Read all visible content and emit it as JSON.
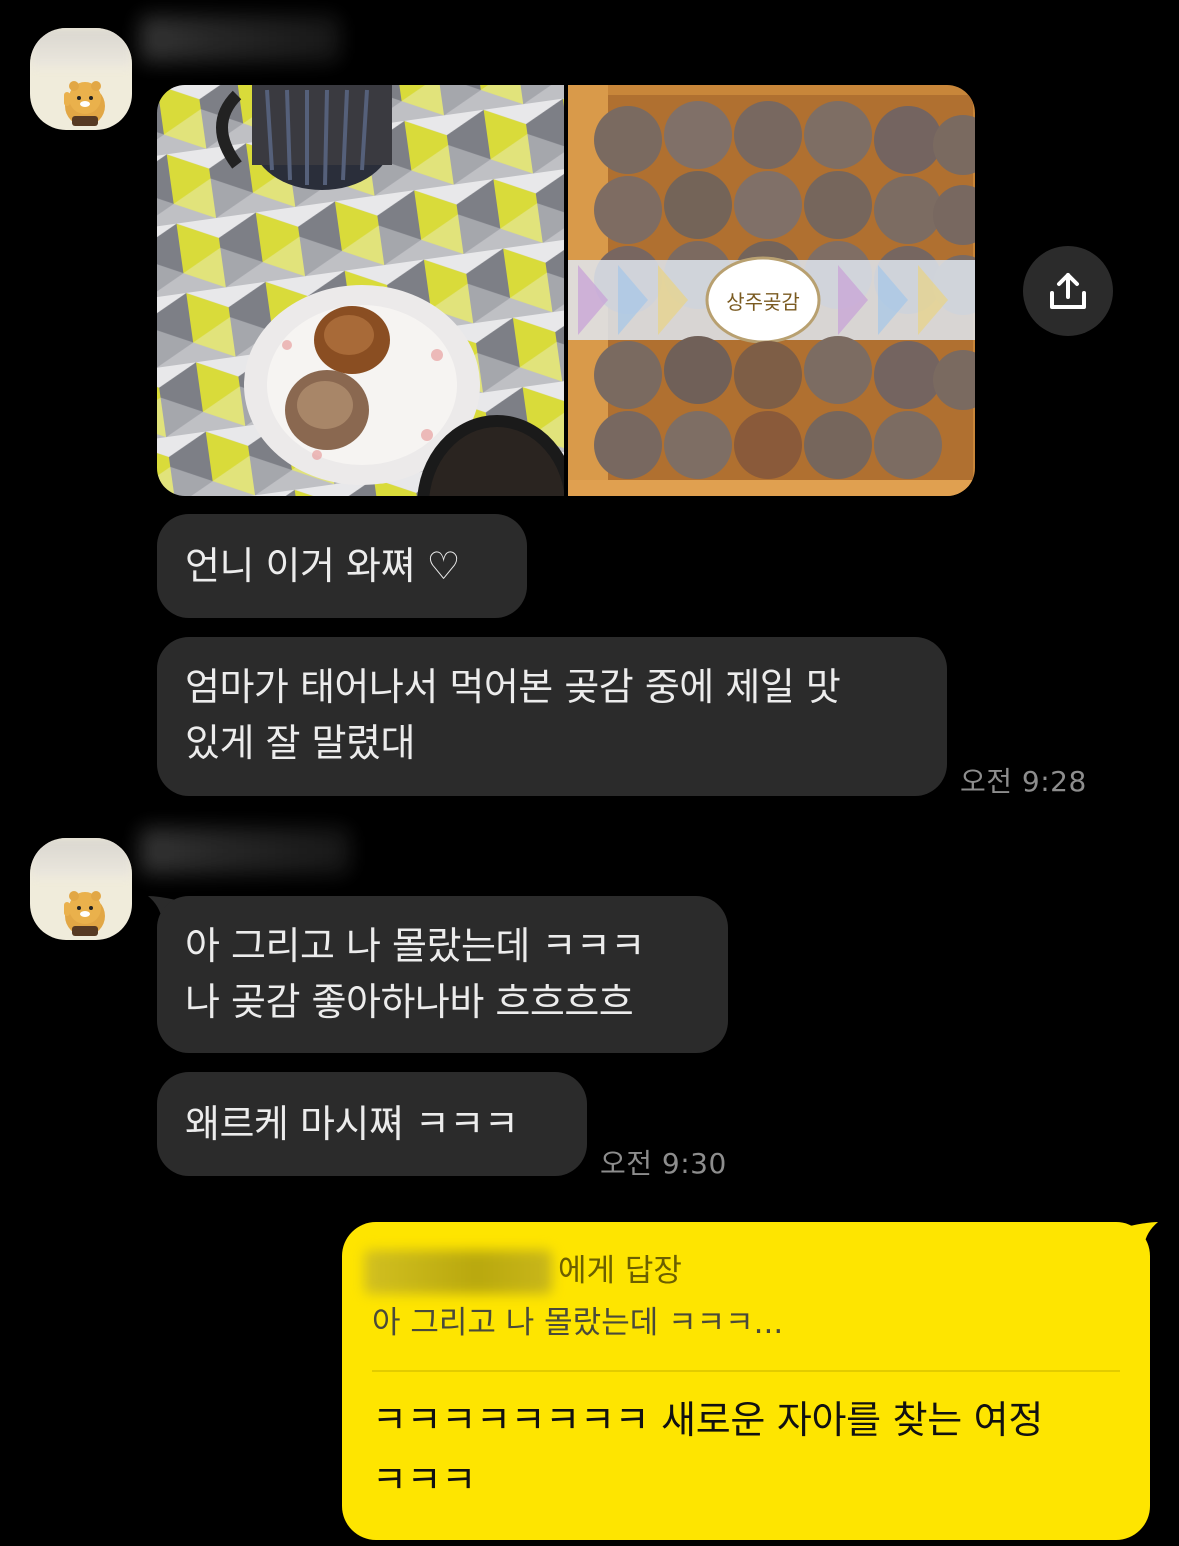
{
  "messages": {
    "group1": {
      "bubble1": "언니 이거 와쪄 ♡",
      "bubble2": "엄마가 태어나서 먹어본 곶감 중에 제일 맛\n있게 잘 말렸대",
      "time": "오전 9:28"
    },
    "group2": {
      "bubble1": "아 그리고 나 몰랐는데 ㅋㅋㅋ\n나 곶감 좋아하나바 흐흐흐흐",
      "bubble2": "왜르케 마시쪄 ㅋㅋㅋ",
      "time": "오전 9:30"
    }
  },
  "reply": {
    "header_suffix": "에게 답장",
    "quoted": "아 그리고 나 몰랐는데 ㅋㅋㅋ...",
    "text": "ㅋㅋㅋㅋㅋㅋㅋㅋ 새로운 자아를 찾는 여정\nㅋㅋㅋ"
  },
  "photo": {
    "box_label": "상주곶감"
  },
  "icons": {
    "share": "share-icon",
    "avatar": "ryan-avatar"
  },
  "colors": {
    "background": "#000000",
    "bubble_other": "#2b2b2b",
    "bubble_mine": "#fee500",
    "time_text": "#8d8d8d"
  }
}
